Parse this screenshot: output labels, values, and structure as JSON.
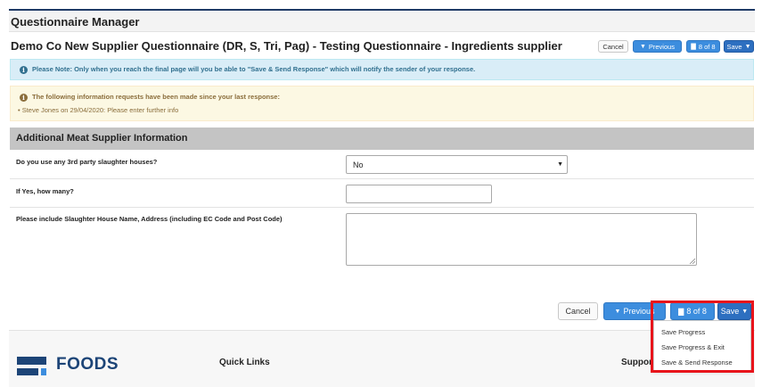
{
  "app": {
    "title": "Questionnaire Manager"
  },
  "questionnaire": {
    "title": "Demo Co New Supplier Questionnaire (DR, S, Tri, Pag) - Testing Questionnaire - Ingredients supplier"
  },
  "top_toolbar": {
    "cancel_label": "Cancel",
    "previous_label": "Previous",
    "page_label": "8 of 8",
    "save_label": "Save"
  },
  "info_alert": {
    "text": "Please Note: Only when you reach the final page will you be able to \"Save & Send Response\" which will notify the sender of your response."
  },
  "warning_alert": {
    "heading": "The following information requests have been made since your last response:",
    "items": [
      "Steve Jones on 29/04/2020: Please enter further info"
    ]
  },
  "section": {
    "title": "Additional Meat Supplier Information"
  },
  "questions": [
    {
      "label": "Do you use any 3rd party slaughter houses?",
      "value": "No"
    },
    {
      "label": "If Yes, how many?",
      "value": ""
    },
    {
      "label": "Please include Slaughter House Name, Address (including EC Code and Post Code)",
      "value": ""
    }
  ],
  "bottom_toolbar": {
    "cancel_label": "Cancel",
    "previous_label": "Previous",
    "page_label": "8 of 8",
    "save_label": "Save"
  },
  "save_menu": {
    "items": [
      "Save Progress",
      "Save Progress & Exit",
      "Save & Send Response"
    ]
  },
  "footer": {
    "logo_text": "FOODS",
    "quick_links_label": "Quick Links",
    "support_label": "Support"
  },
  "colors": {
    "primary_button": "#3c8dde",
    "save_button": "#2d6fc0",
    "info_bg": "#d9edf7",
    "warning_bg": "#fcf8e3",
    "section_header_bg": "#c4c4c4",
    "highlight": "#e8141b"
  },
  "icons": {
    "info": "info-circle-icon",
    "warning": "info-circle-icon",
    "page": "book-icon",
    "caret": "caret-down-icon"
  }
}
